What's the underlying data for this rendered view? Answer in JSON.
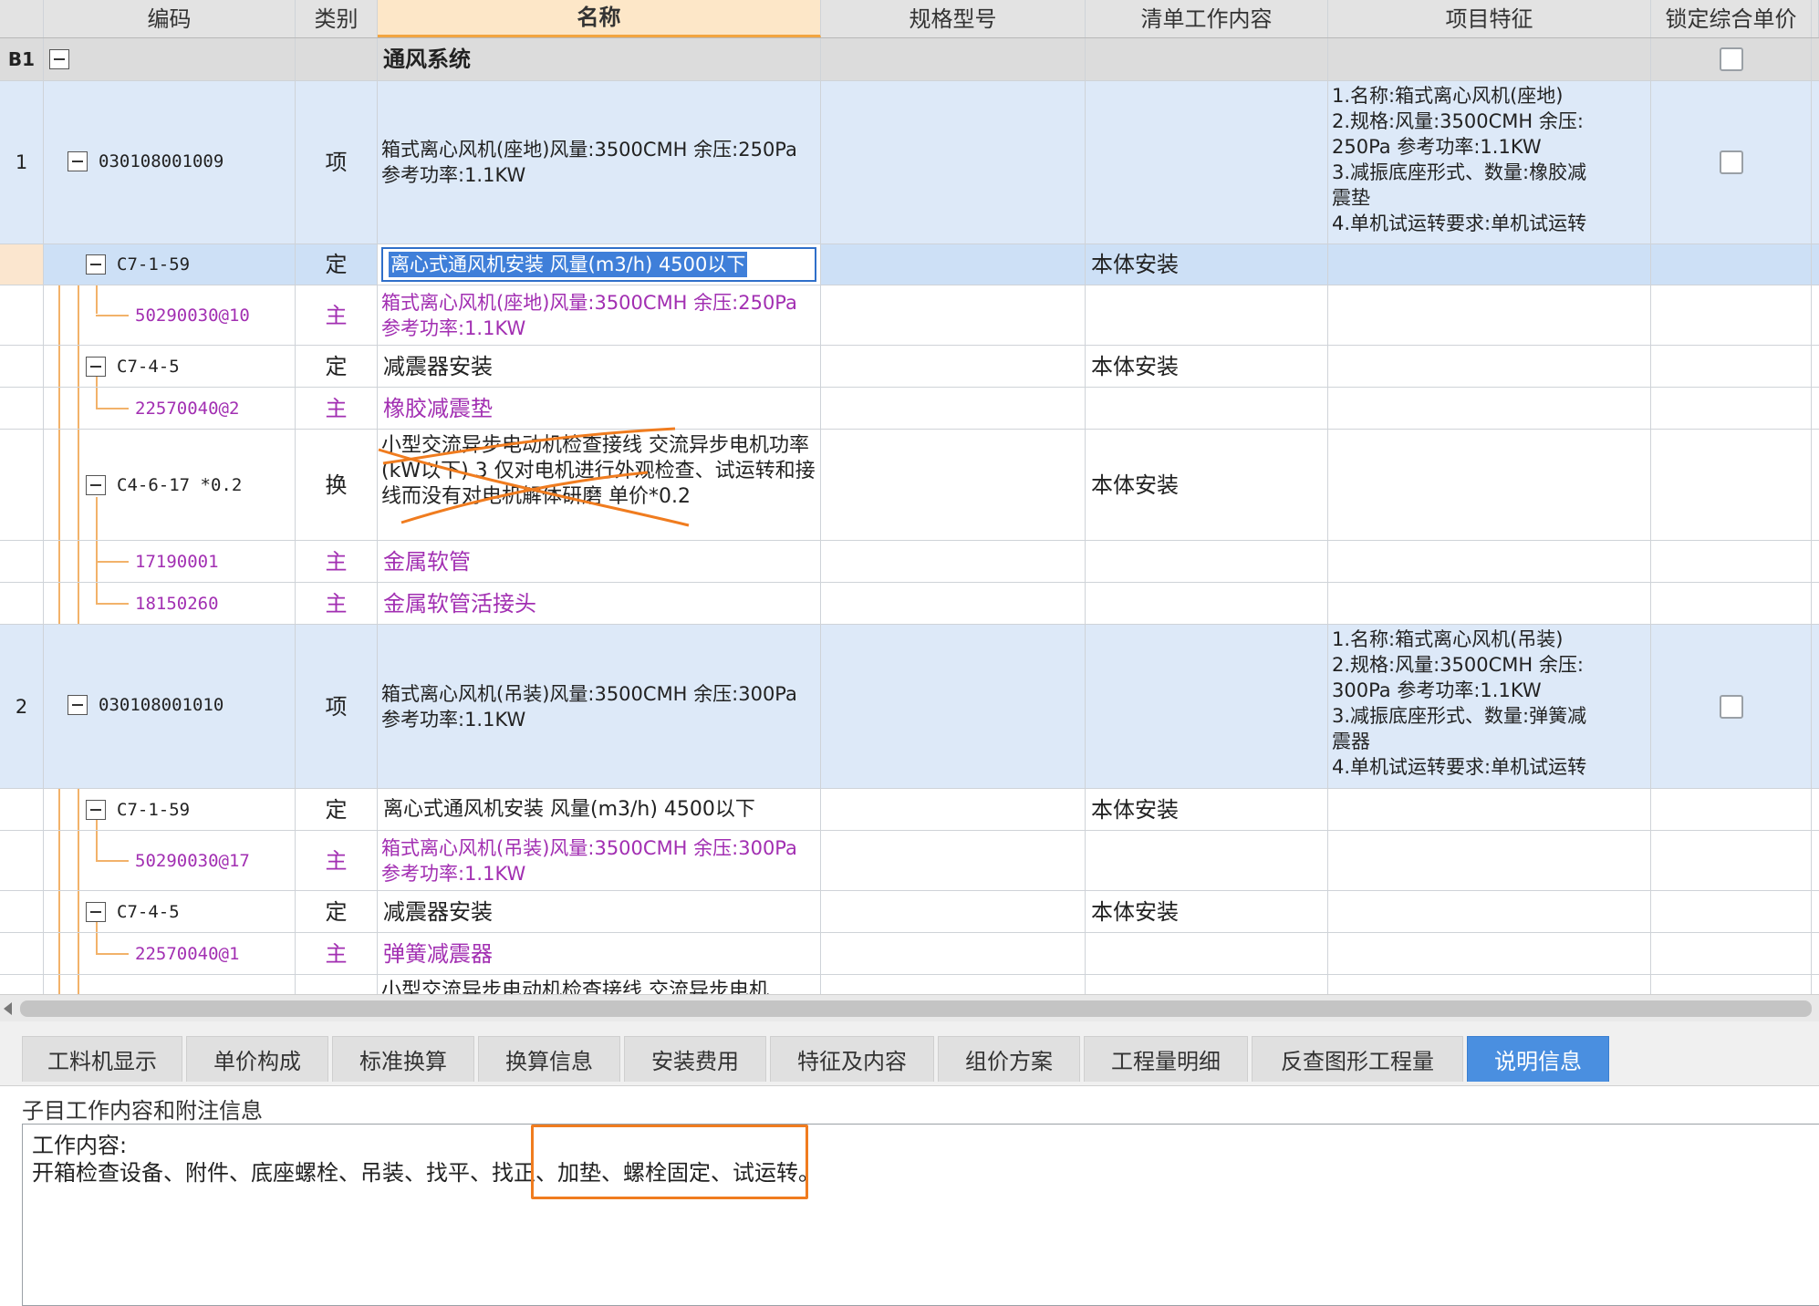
{
  "columns": {
    "code": "编码",
    "type": "类别",
    "name": "名称",
    "spec": "规格型号",
    "work": "清单工作内容",
    "feature": "项目特征",
    "lock": "锁定综合单价"
  },
  "group": {
    "id": "B1",
    "name": "通风系统"
  },
  "rows": {
    "r1": {
      "no": "1",
      "code": "030108001009",
      "type": "项",
      "name": "箱式离心风机(座地)风量:3500CMH 余压:250Pa 参考功率:1.1KW",
      "feature": [
        "1.名称:箱式离心风机(座地)",
        "2.规格:风量:3500CMH 余压:",
        "250Pa 参考功率:1.1KW",
        "3.减振底座形式、数量:橡胶减",
        "震垫",
        "4.单机试运转要求:单机试运转"
      ]
    },
    "r2": {
      "code": "C7-1-59",
      "type": "定",
      "name": "离心式通风机安装 风量(m3/h) 4500以下",
      "work": "本体安装"
    },
    "r3": {
      "code": "50290030@10",
      "type": "主",
      "name": "箱式离心风机(座地)风量:3500CMH 余压:250Pa 参考功率:1.1KW"
    },
    "r4": {
      "code": "C7-4-5",
      "type": "定",
      "name": "减震器安装",
      "work": "本体安装"
    },
    "r5": {
      "code": "22570040@2",
      "type": "主",
      "name": "橡胶减震垫"
    },
    "r6": {
      "code": "C4-6-17 *0.2",
      "type": "换",
      "name": "小型交流异步电动机检查接线 交流异步电机功率(kW以下) 3 仅对电机进行外观检查、试运转和接线而没有对电机解体研磨 单价*0.2",
      "work": "本体安装"
    },
    "r7": {
      "code": "17190001",
      "type": "主",
      "name": "金属软管"
    },
    "r8": {
      "code": "18150260",
      "type": "主",
      "name": "金属软管活接头"
    },
    "r9": {
      "no": "2",
      "code": "030108001010",
      "type": "项",
      "name": "箱式离心风机(吊装)风量:3500CMH 余压:300Pa 参考功率:1.1KW",
      "feature": [
        "1.名称:箱式离心风机(吊装)",
        "2.规格:风量:3500CMH 余压:",
        "300Pa 参考功率:1.1KW",
        "3.减振底座形式、数量:弹簧减",
        "震器",
        "4.单机试运转要求:单机试运转"
      ]
    },
    "r10": {
      "code": "C7-1-59",
      "type": "定",
      "name": "离心式通风机安装 风量(m3/h) 4500以下",
      "work": "本体安装"
    },
    "r11": {
      "code": "50290030@17",
      "type": "主",
      "name": "箱式离心风机(吊装)风量:3500CMH 余压:300Pa 参考功率:1.1KW"
    },
    "r12": {
      "code": "C7-4-5",
      "type": "定",
      "name": "减震器安装",
      "work": "本体安装"
    },
    "r13": {
      "code": "22570040@1",
      "type": "主",
      "name": "弹簧减震器"
    },
    "r14": {
      "name": "小型交流异步电动机检查接线 交流异步电机"
    }
  },
  "tabs": [
    "工料机显示",
    "单价构成",
    "标准换算",
    "换算信息",
    "安装费用",
    "特征及内容",
    "组价方案",
    "工程量明细",
    "反查图形工程量",
    "说明信息"
  ],
  "panel": {
    "subtitle": "子目工作内容和附注信息",
    "work_title": "工作内容:",
    "work_text": "开箱检查设备、附件、底座螺栓、吊装、找平、找正、加垫、螺栓固定、试运转。"
  },
  "colors": {
    "qd_row": "#dde9f8",
    "active_row": "#cde0f6",
    "main_material": "#a22fb2",
    "active_tab": "#4a8fe0",
    "annotation": "#f07c1f"
  }
}
